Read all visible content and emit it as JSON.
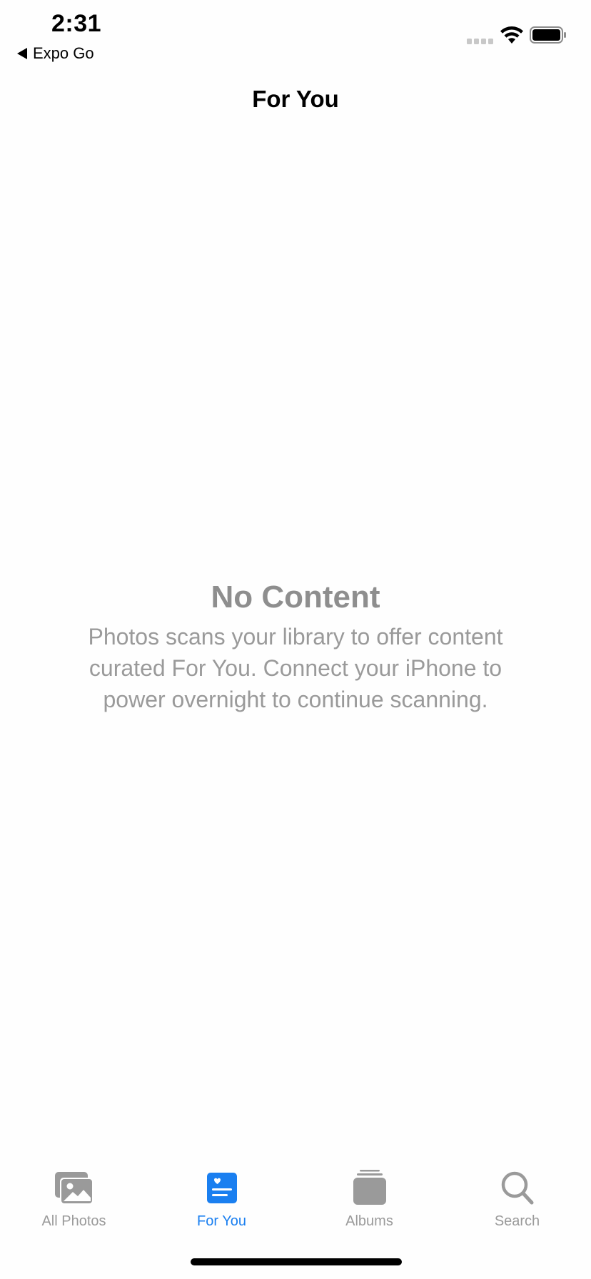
{
  "status_bar": {
    "time": "2:31",
    "back_app_label": "Expo Go"
  },
  "nav": {
    "title": "For You"
  },
  "empty_state": {
    "title": "No Content",
    "message": "Photos scans your library to offer content curated For You. Connect your iPhone to power overnight to continue scanning."
  },
  "tab_bar": {
    "active_tab": "For You",
    "tabs": [
      {
        "label": "All Photos",
        "icon": "photos-stack-icon"
      },
      {
        "label": "For You",
        "icon": "for-you-heart-card-icon"
      },
      {
        "label": "Albums",
        "icon": "albums-stack-icon"
      },
      {
        "label": "Search",
        "icon": "search-icon"
      }
    ]
  },
  "colors": {
    "accent": "#1a7ff0",
    "inactive_tab": "#9a9a9a",
    "empty_title": "#8e8e8e",
    "empty_body": "#9a9a9a"
  }
}
